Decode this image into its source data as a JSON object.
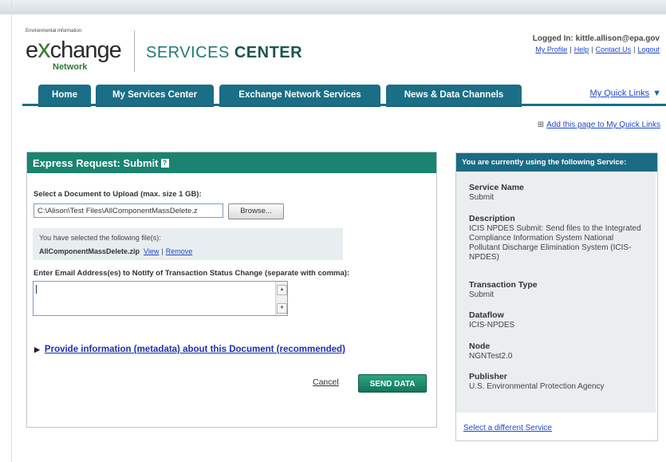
{
  "header": {
    "logo_top": "Environmental Information",
    "logo_main_e": "e",
    "logo_main_x": "x",
    "logo_main_rest": "change",
    "logo_network": "Network",
    "title_plain": "SERVICES",
    "title_bold": "CENTER",
    "logged_label": "Logged In:",
    "logged_user": "kittle.allison@epa.gov",
    "links": [
      "My Profile",
      "Help",
      "Contact Us",
      "Logout"
    ]
  },
  "nav": {
    "tabs": [
      "Home",
      "My Services Center",
      "Exchange Network Services",
      "News & Data Channels"
    ],
    "quick_links": "My Quick Links",
    "add_page": "Add this page to My Quick Links"
  },
  "form": {
    "title": "Express Request: Submit",
    "upload_label": "Select a Document to Upload (max. size 1 GB):",
    "file_value": "C:\\Alison\\Test Files\\AllComponentMassDelete.z",
    "browse_label": "Browse...",
    "selected_label": "You have selected the following file(s):",
    "selected_file": "AllComponentMassDelete.zip",
    "view_label": "View",
    "remove_label": "Remove",
    "email_label": "Enter Email Address(es) to Notify of Transaction Status Change (separate with comma):",
    "email_value": "",
    "metadata_link": "Provide information (metadata) about this Document (recommended)",
    "cancel_label": "Cancel",
    "send_label": "SEND DATA"
  },
  "service": {
    "header": "You are currently using the following Service:",
    "fields": [
      {
        "key": "Service Name",
        "value": "Submit"
      },
      {
        "key": "Description",
        "value": "ICIS NPDES Submit: Send files to the Integrated Compliance Information System National Pollutant Discharge Elimination System (ICIS-NPDES)"
      },
      {
        "key": "Transaction Type",
        "value": "Submit"
      },
      {
        "key": "Dataflow",
        "value": "ICIS-NPDES"
      },
      {
        "key": "Node",
        "value": "NGNTest2.0"
      },
      {
        "key": "Publisher",
        "value": "U.S. Environmental Protection Agency"
      }
    ],
    "footer_link": "Select a different Service"
  },
  "colors": {
    "nav_blue": "#1a6e86",
    "panel_green": "#1a8470",
    "link_blue": "#1f48c9"
  }
}
